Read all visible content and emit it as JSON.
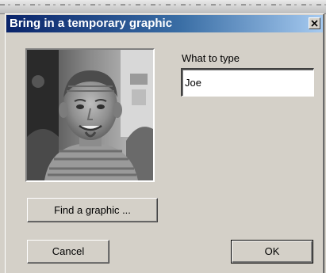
{
  "dialog": {
    "title": "Bring in a temporary graphic",
    "close_icon": "close-icon"
  },
  "preview": {
    "icon": "photo-preview",
    "description_hidden": true
  },
  "input": {
    "label": "What to type",
    "value": "Joe"
  },
  "buttons": {
    "find_label": "Find a graphic ...",
    "cancel_label": "Cancel",
    "ok_label": "OK"
  },
  "colors": {
    "title_bar_start": "#0a246a",
    "title_bar_end": "#a6caf0",
    "face": "#d4d0c8"
  }
}
